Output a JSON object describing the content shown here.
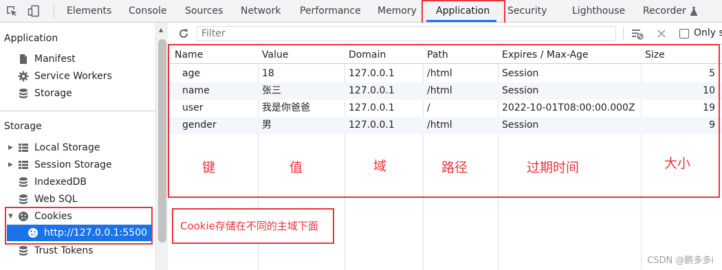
{
  "tabs": [
    {
      "label": "Elements"
    },
    {
      "label": "Console"
    },
    {
      "label": "Sources"
    },
    {
      "label": "Network"
    },
    {
      "label": "Performance"
    },
    {
      "label": "Memory"
    },
    {
      "label": "Application",
      "active": true
    },
    {
      "label": "Security"
    },
    {
      "label": "Lighthouse"
    },
    {
      "label": "Recorder"
    }
  ],
  "sidebar": {
    "application_heading": "Application",
    "app_items": [
      "Manifest",
      "Service Workers",
      "Storage"
    ],
    "storage_heading": "Storage",
    "storage_items": [
      "Local Storage",
      "Session Storage",
      "IndexedDB",
      "Web SQL",
      "Cookies",
      "http://127.0.0.1:5500",
      "Trust Tokens"
    ]
  },
  "toolbar": {
    "filter_placeholder": "Filter",
    "only_label": "Only s"
  },
  "table": {
    "columns": [
      "Name",
      "Value",
      "Domain",
      "Path",
      "Expires / Max-Age",
      "Size"
    ],
    "rows": [
      [
        "age",
        "18",
        "127.0.0.1",
        "/html",
        "Session",
        "5"
      ],
      [
        "name",
        "张三",
        "127.0.0.1",
        "/html",
        "Session",
        "10"
      ],
      [
        "user",
        "我是你爸爸",
        "127.0.0.1",
        "/",
        "2022-10-01T08:00:00.000Z",
        "19"
      ],
      [
        "gender",
        "男",
        "127.0.0.1",
        "/html",
        "Session",
        "9"
      ]
    ]
  },
  "annotations": {
    "columns_cn": [
      "键",
      "值",
      "域",
      "路径",
      "过期时间",
      "大小"
    ],
    "cookie_note": "Cookie存储在不同的主域下面"
  },
  "watermark": "CSDN @鹏多多i",
  "colors": {
    "accent": "#1a73e8",
    "annotation_red": "#e8333a"
  }
}
